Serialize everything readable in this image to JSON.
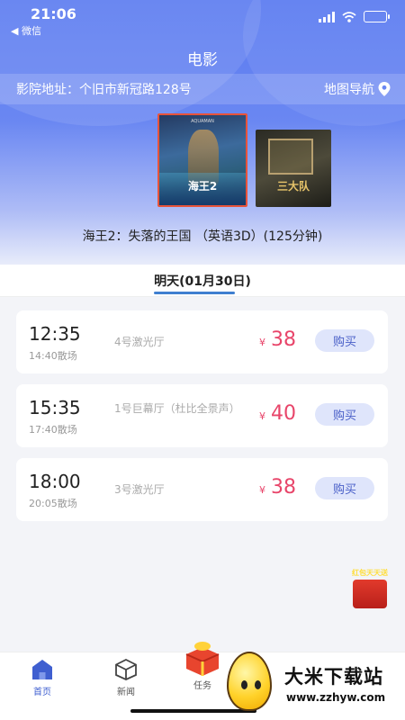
{
  "status_bar": {
    "time": "21:06",
    "back_label": "◀ 微信"
  },
  "header": {
    "title": "电影"
  },
  "cinema": {
    "address_label": "影院地址：个旧市新冠路128号",
    "map_nav_label": "地图导航"
  },
  "posters": [
    {
      "top_text": "AQUAMAN",
      "title": "海王2"
    },
    {
      "title": "三大队"
    }
  ],
  "movie": {
    "title": "海王2：失落的王国 （英语3D）(125分钟)"
  },
  "date_tab": {
    "label": "明天(01月30日)"
  },
  "showtimes": [
    {
      "start": "12:35",
      "end": "14:40散场",
      "hall": "4号激光厅",
      "currency": "¥",
      "price": "38",
      "buy_label": "购买"
    },
    {
      "start": "15:35",
      "end": "17:40散场",
      "hall": "1号巨幕厅（杜比全景声）",
      "currency": "¥",
      "price": "40",
      "buy_label": "购买"
    },
    {
      "start": "18:00",
      "end": "20:05散场",
      "hall": "3号激光厅",
      "currency": "¥",
      "price": "38",
      "buy_label": "购买"
    }
  ],
  "promo": {
    "label": "红包天天送"
  },
  "tabbar": {
    "items": [
      {
        "label": "首页",
        "icon": "home-icon",
        "active": true
      },
      {
        "label": "新闻",
        "icon": "cube-icon",
        "active": false
      },
      {
        "label": "任务",
        "icon": "gift-icon",
        "active": false
      }
    ]
  },
  "watermark": {
    "title": "大米下载站",
    "url": "www.zzhyw.com"
  },
  "colors": {
    "accent": "#5a7af0",
    "price": "#e8456a",
    "buy_bg": "#dfe5fb",
    "tab_underline": "#3f7fd0"
  }
}
